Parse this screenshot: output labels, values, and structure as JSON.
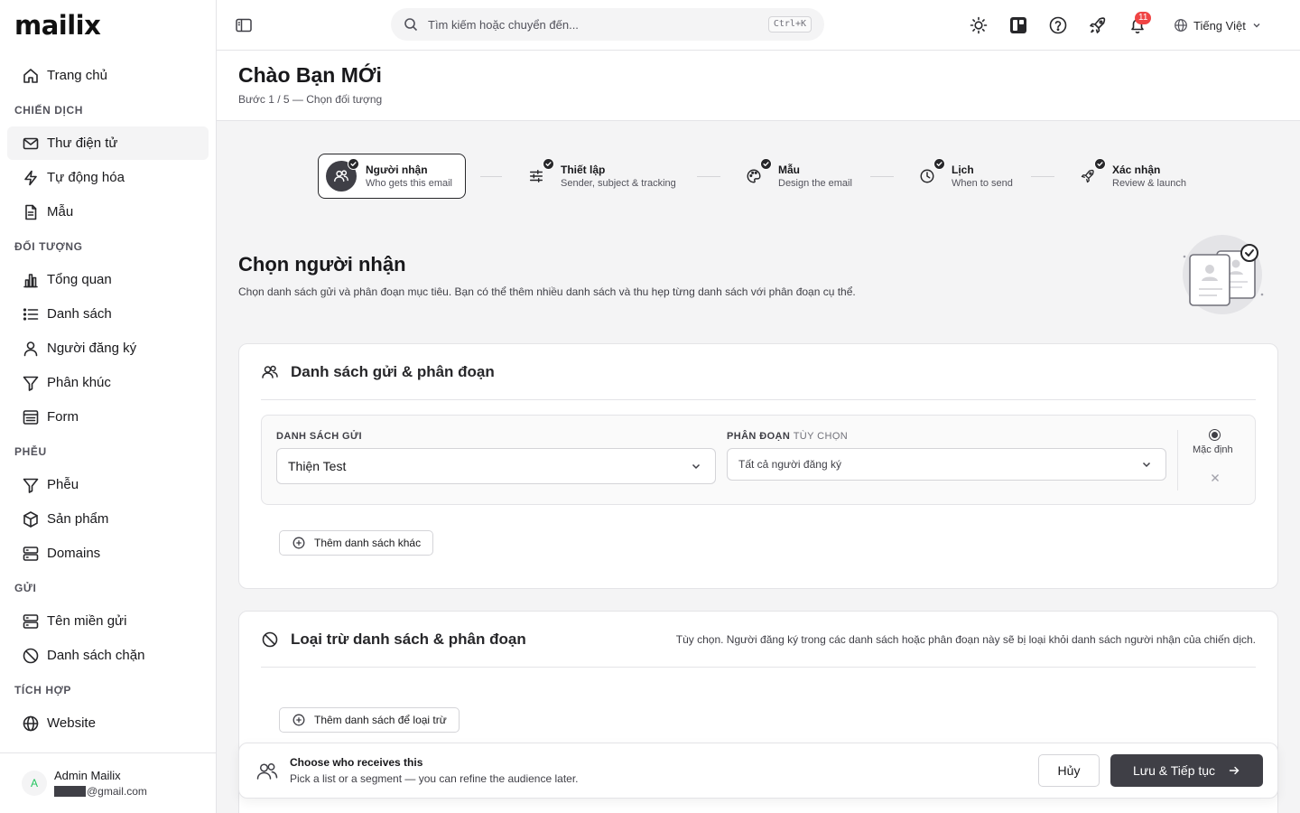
{
  "app": {
    "logo": "mailix"
  },
  "sidebar": {
    "items": [
      {
        "type": "item",
        "label": "Trang chủ",
        "icon": "home-icon"
      },
      {
        "type": "section",
        "label": "CHIẾN DỊCH"
      },
      {
        "type": "item",
        "label": "Thư điện tử",
        "icon": "mail-icon",
        "active": true
      },
      {
        "type": "item",
        "label": "Tự động hóa",
        "icon": "lightning-icon"
      },
      {
        "type": "item",
        "label": "Mẫu",
        "icon": "document-icon"
      },
      {
        "type": "section",
        "label": "ĐỐI TƯỢNG"
      },
      {
        "type": "item",
        "label": "Tổng quan",
        "icon": "chart-icon"
      },
      {
        "type": "item",
        "label": "Danh sách",
        "icon": "list-icon"
      },
      {
        "type": "item",
        "label": "Người đăng ký",
        "icon": "user-icon"
      },
      {
        "type": "item",
        "label": "Phân khúc",
        "icon": "filter-icon"
      },
      {
        "type": "item",
        "label": "Form",
        "icon": "form-icon"
      },
      {
        "type": "section",
        "label": "PHỄU"
      },
      {
        "type": "item",
        "label": "Phễu",
        "icon": "funnel-icon"
      },
      {
        "type": "item",
        "label": "Sản phẩm",
        "icon": "box-icon"
      },
      {
        "type": "item",
        "label": "Domains",
        "icon": "server-icon"
      },
      {
        "type": "section",
        "label": "GỬI"
      },
      {
        "type": "item",
        "label": "Tên miền gửi",
        "icon": "server-icon"
      },
      {
        "type": "item",
        "label": "Danh sách chặn",
        "icon": "ban-icon"
      },
      {
        "type": "section",
        "label": "TÍCH HỢP"
      },
      {
        "type": "item",
        "label": "Website",
        "icon": "globe-icon"
      }
    ]
  },
  "user": {
    "avatar": "A",
    "name": "Admin Mailix",
    "email_suffix": "@gmail.com"
  },
  "topbar": {
    "search_placeholder": "Tìm kiếm hoặc chuyển đến...",
    "shortcut": "Ctrl+K",
    "notification_count": "11",
    "language": "Tiếng Việt"
  },
  "header": {
    "title": "Chào Bạn MỚi",
    "subtitle": "Bước 1 / 5 — Chọn đối tượng"
  },
  "stepper": [
    {
      "title": "Người nhận",
      "desc": "Who gets this email",
      "icon": "users-icon",
      "active": true
    },
    {
      "title": "Thiết lập",
      "desc": "Sender, subject & tracking",
      "icon": "sliders-icon"
    },
    {
      "title": "Mẫu",
      "desc": "Design the email",
      "icon": "palette-icon"
    },
    {
      "title": "Lịch",
      "desc": "When to send",
      "icon": "clock-icon"
    },
    {
      "title": "Xác nhận",
      "desc": "Review & launch",
      "icon": "rocket-icon"
    }
  ],
  "section": {
    "title": "Chọn người nhận",
    "desc": "Chọn danh sách gửi và phân đoạn mục tiêu. Bạn có thể thêm nhiều danh sách và thu hẹp từng danh sách với phân đoạn cụ thể."
  },
  "lists_card": {
    "title": "Danh sách gửi & phân đoạn",
    "list_label": "DANH SÁCH GỬI",
    "list_value": "Thiện Test",
    "segment_label": "PHÂN ĐOẠN",
    "segment_optional": "TÙY CHỌN",
    "segment_value": "Tất cả người đăng ký",
    "default_label": "Mặc định",
    "add_button": "Thêm danh sách khác"
  },
  "exclude_card": {
    "title": "Loại trừ danh sách & phân đoạn",
    "note": "Tùy chọn. Người đăng ký trong các danh sách hoặc phân đoạn này sẽ bị loại khỏi danh sách người nhận của chiến dịch.",
    "add_button": "Thêm danh sách để loại trừ"
  },
  "bottom_bar": {
    "title": "Choose who receives this",
    "desc": "Pick a list or a segment — you can refine the audience later.",
    "cancel": "Hủy",
    "primary": "Lưu & Tiếp tục"
  }
}
